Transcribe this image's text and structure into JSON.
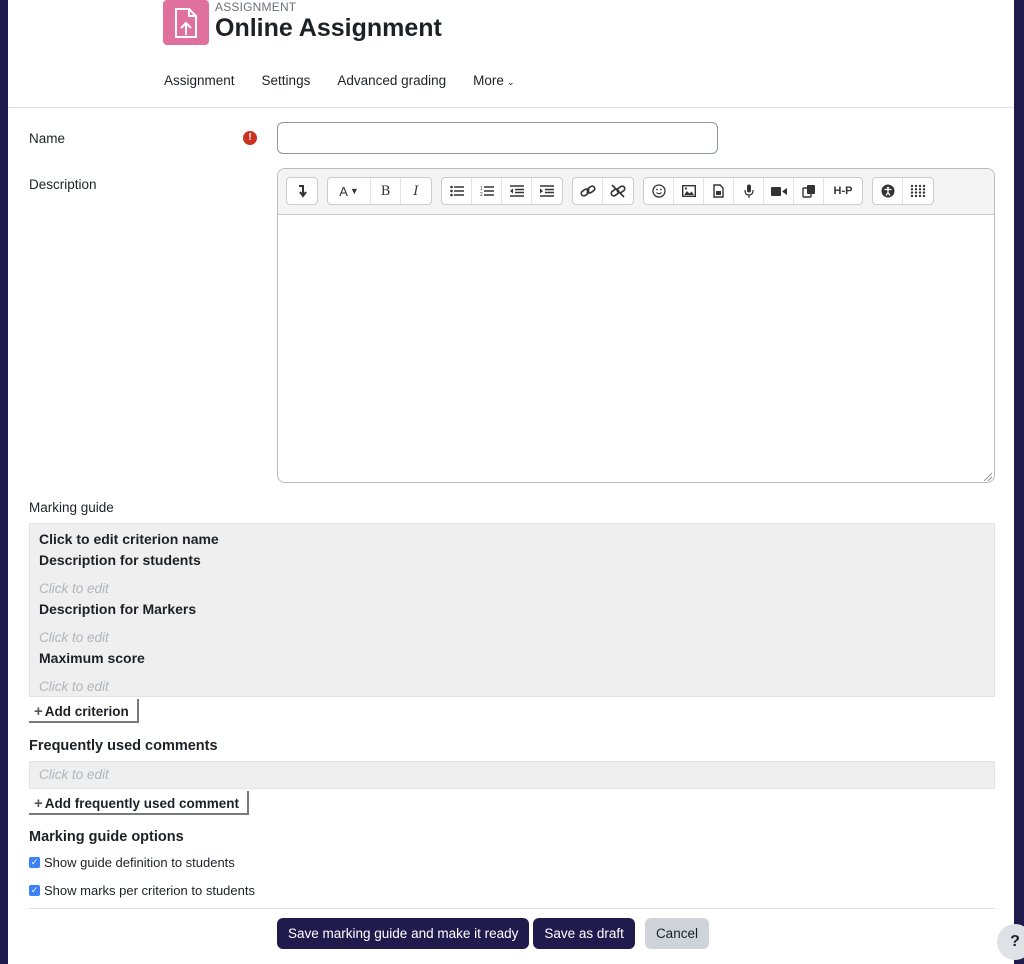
{
  "header": {
    "pre_title": "ASSIGNMENT",
    "title": "Online Assignment",
    "module_icon": "assignment-upload-icon",
    "module_color": "#e0719e"
  },
  "nav": {
    "items": [
      {
        "label": "Assignment"
      },
      {
        "label": "Settings"
      },
      {
        "label": "Advanced grading"
      },
      {
        "label": "More"
      }
    ]
  },
  "form": {
    "name_label": "Name",
    "name_value": "",
    "required_icon": "!",
    "description_label": "Description",
    "toolbar": {
      "groups": [
        [
          "collapse"
        ],
        [
          "font-color",
          "bold",
          "italic"
        ],
        [
          "unordered-list",
          "ordered-list",
          "outdent",
          "indent"
        ],
        [
          "link",
          "unlink"
        ],
        [
          "emoji",
          "image",
          "media",
          "record-audio",
          "record-video",
          "manage-files",
          "h5p"
        ],
        [
          "accessibility-checker",
          "screenreader-helper"
        ]
      ],
      "bold_glyph": "B",
      "italic_glyph": "I",
      "h5p_glyph": "H-P"
    },
    "description_value": ""
  },
  "marking_guide": {
    "label": "Marking guide",
    "criterion_name": "Click to edit criterion name",
    "desc_students_label": "Description for students",
    "desc_students_value": "Click to edit",
    "desc_markers_label": "Description for Markers",
    "desc_markers_value": "Click to edit",
    "max_score_label": "Maximum score",
    "max_score_value": "Click to edit",
    "add_criterion": "Add criterion"
  },
  "comments": {
    "heading": "Frequently used comments",
    "value": "Click to edit",
    "add_comment": "Add frequently used comment"
  },
  "options": {
    "heading": "Marking guide options",
    "items": [
      {
        "label": "Show guide definition to students",
        "checked": true
      },
      {
        "label": "Show marks per criterion to students",
        "checked": true
      }
    ]
  },
  "footer": {
    "save_ready": "Save marking guide and make it ready",
    "save_draft": "Save as draft",
    "cancel": "Cancel",
    "help": "?"
  },
  "colors": {
    "primary": "#211a4d",
    "required": "#ca3120",
    "checkbox": "#3b82f6"
  }
}
